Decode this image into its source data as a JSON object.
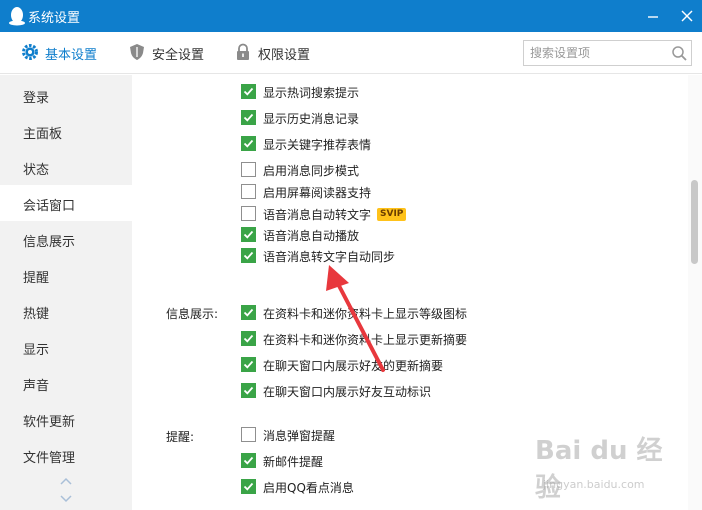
{
  "window": {
    "title": "系统设置"
  },
  "nav": {
    "tabs": [
      {
        "label": "基本设置",
        "icon": "gear-icon",
        "active": true
      },
      {
        "label": "安全设置",
        "icon": "shield-icon",
        "active": false
      },
      {
        "label": "权限设置",
        "icon": "lock-icon",
        "active": false
      }
    ]
  },
  "search": {
    "placeholder": "搜索设置项"
  },
  "sidebar": {
    "items": [
      {
        "label": "登录"
      },
      {
        "label": "主面板"
      },
      {
        "label": "状态"
      },
      {
        "label": "会话窗口",
        "active": true
      },
      {
        "label": "信息展示"
      },
      {
        "label": "提醒"
      },
      {
        "label": "热键"
      },
      {
        "label": "显示"
      },
      {
        "label": "声音"
      },
      {
        "label": "软件更新"
      },
      {
        "label": "文件管理"
      }
    ]
  },
  "content": {
    "session": [
      {
        "label": "显示热词搜索提示",
        "checked": true
      },
      {
        "label": "显示历史消息记录",
        "checked": true
      },
      {
        "label": "显示关键字推荐表情",
        "checked": true
      },
      {
        "label": "启用消息同步模式",
        "checked": false
      },
      {
        "label": "启用屏幕阅读器支持",
        "checked": false
      },
      {
        "label": "语音消息自动转文字",
        "checked": false,
        "badge": "SVIP"
      },
      {
        "label": "语音消息自动播放",
        "checked": true
      },
      {
        "label": "语音消息转文字自动同步",
        "checked": true
      }
    ],
    "info_display": {
      "label": "信息展示:",
      "options": [
        {
          "label": "在资料卡和迷你资料卡上显示等级图标",
          "checked": true
        },
        {
          "label": "在资料卡和迷你资料卡上显示更新摘要",
          "checked": true
        },
        {
          "label": "在聊天窗口内展示好友的更新摘要",
          "checked": true
        },
        {
          "label": "在聊天窗口内展示好友互动标识",
          "checked": true
        }
      ]
    },
    "reminder": {
      "label": "提醒:",
      "options": [
        {
          "label": "消息弹窗提醒",
          "checked": false
        },
        {
          "label": "新邮件提醒",
          "checked": true
        },
        {
          "label": "启用QQ看点消息",
          "checked": true
        }
      ]
    }
  },
  "colors": {
    "titlebar": "#0f7ecc",
    "checkbox_on": "#3aa447",
    "annotation_arrow": "#e8383d",
    "badge": "#ffc21a"
  },
  "watermark": {
    "logo": "Bai du 经验",
    "url": "jingyan.baidu.com"
  }
}
